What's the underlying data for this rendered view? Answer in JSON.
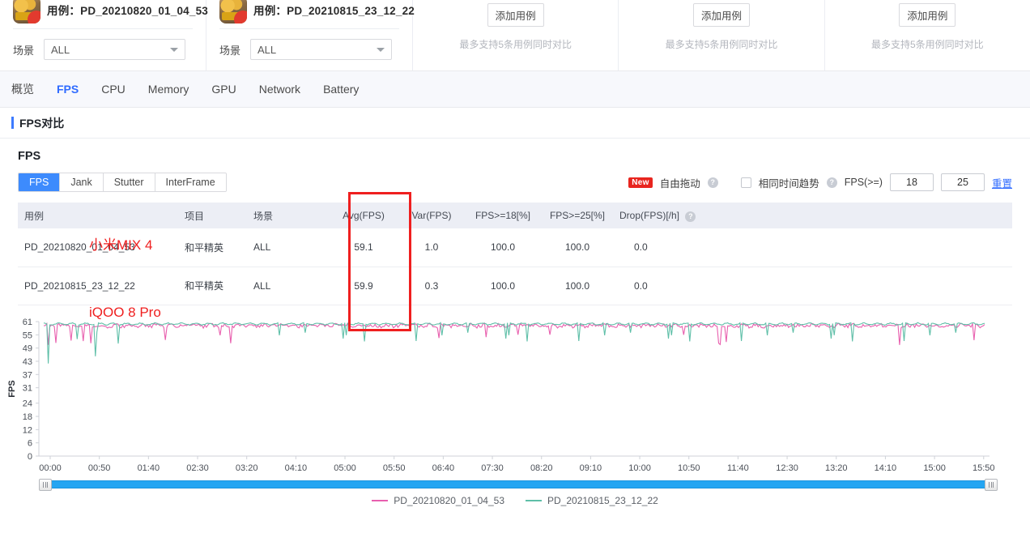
{
  "cases": [
    {
      "title_label": "用例：",
      "title": "PD_20210820_01_04_53",
      "scene_label": "场景",
      "scene_value": "ALL",
      "icon": "game-app-icon"
    },
    {
      "title_label": "用例：",
      "title": "PD_20210815_23_12_22",
      "scene_label": "场景",
      "scene_value": "ALL",
      "icon": "game-app-icon"
    }
  ],
  "add_cards": [
    {
      "button_label": "添加用例",
      "hint": "最多支持5条用例同时对比"
    },
    {
      "button_label": "添加用例",
      "hint": "最多支持5条用例同时对比"
    },
    {
      "button_label": "添加用例",
      "hint": "最多支持5条用例同时对比"
    }
  ],
  "nav_tabs": [
    {
      "label": "概览",
      "active": false
    },
    {
      "label": "FPS",
      "active": true
    },
    {
      "label": "CPU",
      "active": false
    },
    {
      "label": "Memory",
      "active": false
    },
    {
      "label": "GPU",
      "active": false
    },
    {
      "label": "Network",
      "active": false
    },
    {
      "label": "Battery",
      "active": false
    }
  ],
  "section": {
    "title": "FPS对比"
  },
  "panel": {
    "heading": "FPS",
    "sub_tabs": [
      {
        "label": "FPS",
        "active": true
      },
      {
        "label": "Jank",
        "active": false
      },
      {
        "label": "Stutter",
        "active": false
      },
      {
        "label": "InterFrame",
        "active": false
      }
    ],
    "controls": {
      "new_badge": "New",
      "free_drag_label": "自由拖动",
      "help_icon_1": "?",
      "same_time_label": "相同时间趋势",
      "help_icon_2": "?",
      "fps_threshold_label": "FPS(>=)",
      "threshold_low": "18",
      "threshold_high": "25",
      "reset_label": "重置"
    }
  },
  "table": {
    "columns": [
      "用例",
      "项目",
      "场景",
      "Avg(FPS)",
      "Var(FPS)",
      "FPS>=18[%]",
      "FPS>=25[%]",
      "Drop(FPS)[/h]"
    ],
    "drop_help_icon": "?",
    "rows": [
      {
        "case": "PD_20210820_01_04_53",
        "project": "和平精英",
        "scene": "ALL",
        "avg_fps": "59.1",
        "var_fps": "1.0",
        "fps_ge_18": "100.0",
        "fps_ge_25": "100.0",
        "drop_fps": "0.0"
      },
      {
        "case": "PD_20210815_23_12_22",
        "project": "和平精英",
        "scene": "ALL",
        "avg_fps": "59.9",
        "var_fps": "0.3",
        "fps_ge_18": "100.0",
        "fps_ge_25": "100.0",
        "drop_fps": "0.0"
      }
    ]
  },
  "annotations": [
    {
      "text": "小米MIX 4",
      "color": "#ef1f1f"
    },
    {
      "text": "iQOO 8 Pro",
      "color": "#ef1f1f"
    }
  ],
  "highlight_box": {
    "color": "#ef1f1f",
    "target_column": "Avg(FPS)"
  },
  "chart_data": {
    "type": "line",
    "title": "",
    "xlabel": "",
    "ylabel": "FPS",
    "ylim": [
      0,
      61
    ],
    "yticks": [
      0,
      6,
      12,
      18,
      24,
      31,
      37,
      43,
      49,
      55,
      61
    ],
    "xticks": [
      "00:00",
      "00:50",
      "01:40",
      "02:30",
      "03:20",
      "04:10",
      "05:00",
      "05:50",
      "06:40",
      "07:30",
      "08:20",
      "09:10",
      "10:00",
      "10:50",
      "11:40",
      "12:30",
      "13:20",
      "14:10",
      "15:00",
      "15:50"
    ],
    "grid": false,
    "legend_position": "bottom",
    "series": [
      {
        "name": "PD_20210820_01_04_53",
        "color": "#e85fae",
        "avg": 59.1,
        "var": 1.0,
        "min": 50,
        "max": 61
      },
      {
        "name": "PD_20210815_23_12_22",
        "color": "#5fbfa8",
        "avg": 59.9,
        "var": 0.3,
        "min": 42,
        "max": 61
      }
    ]
  },
  "slider": {
    "handle_left": "drag-handle",
    "handle_right": "drag-handle",
    "fill_color": "#24a5f2"
  }
}
